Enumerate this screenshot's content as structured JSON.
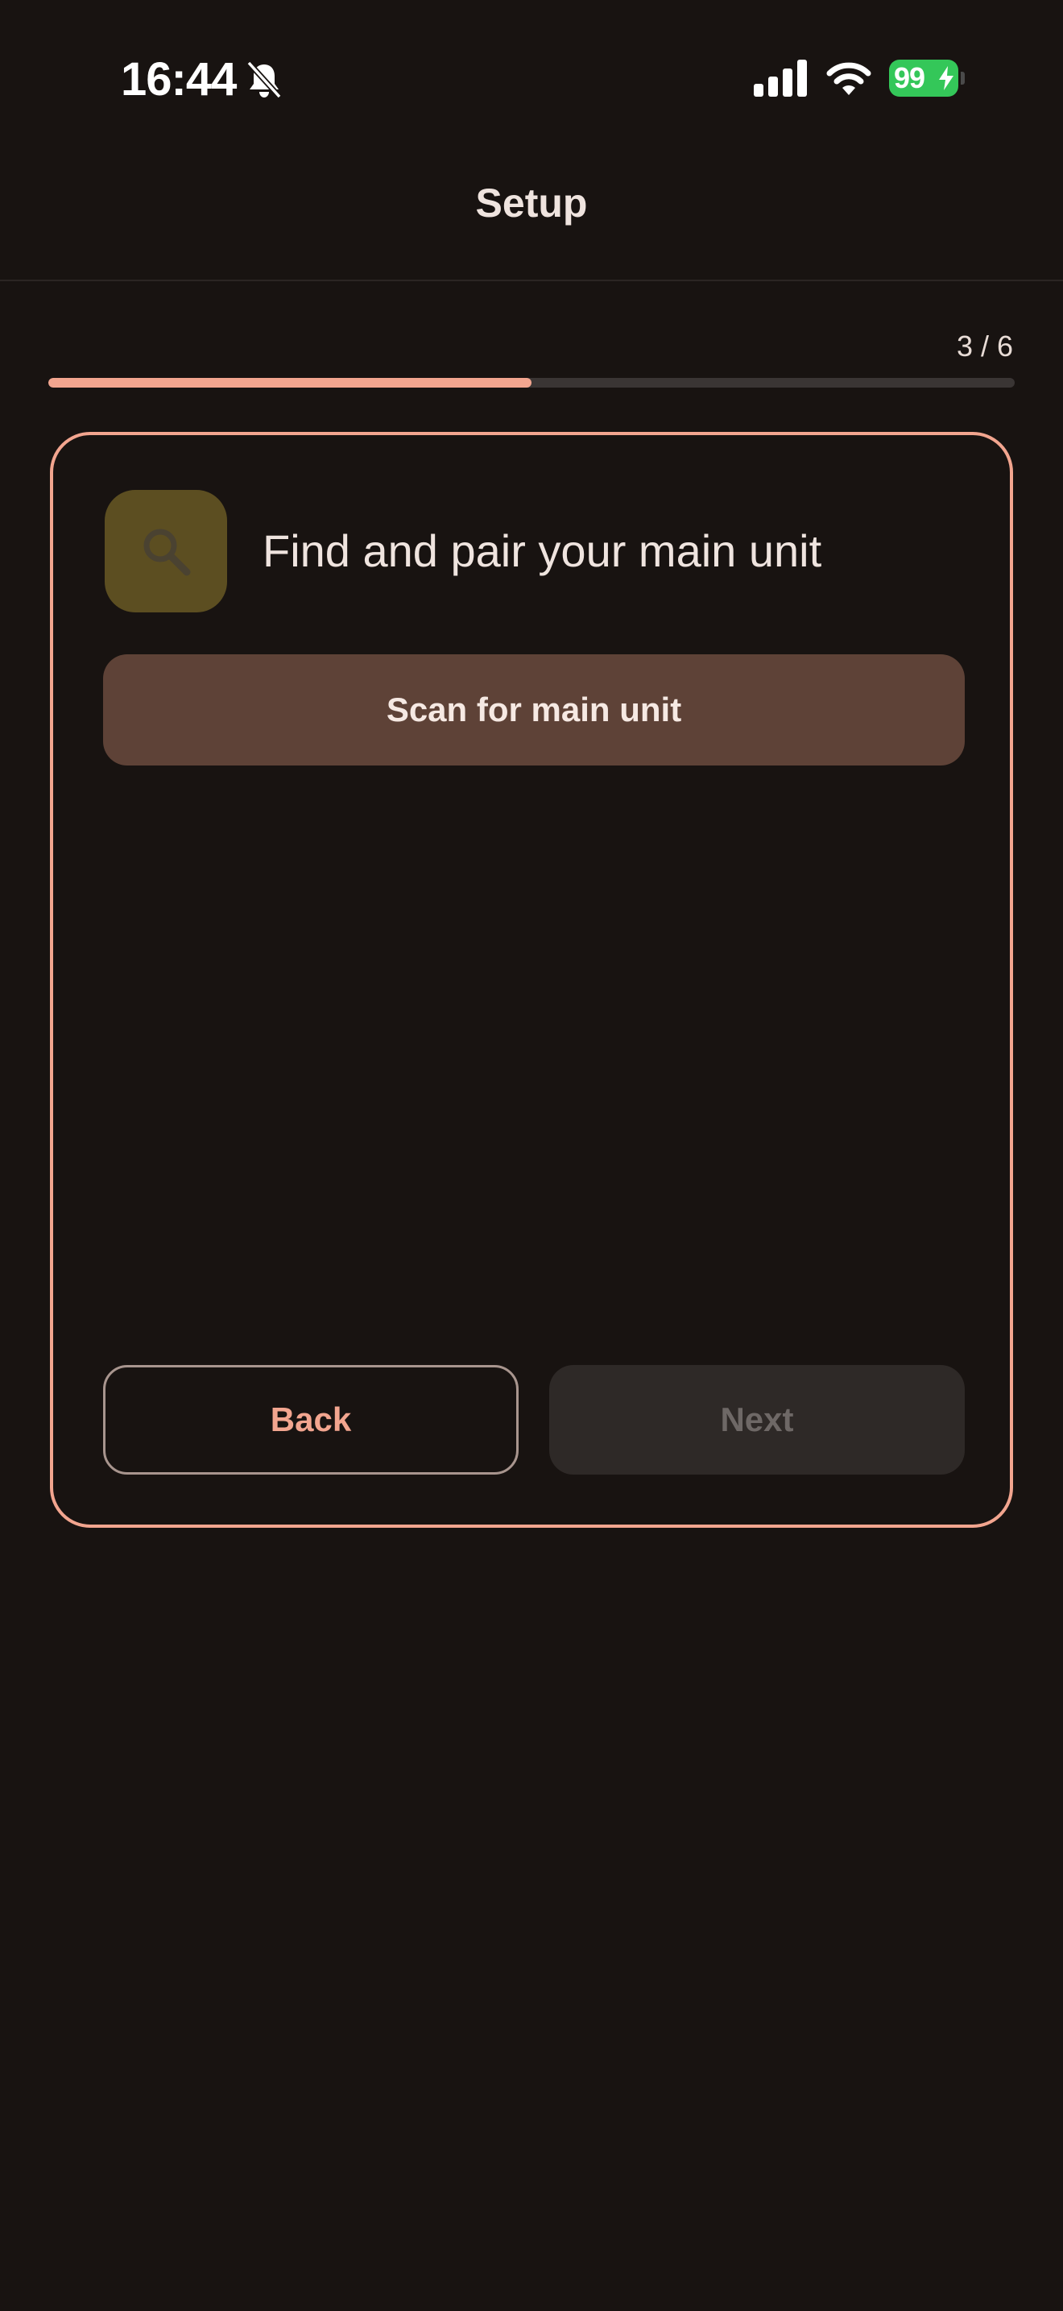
{
  "status_bar": {
    "time": "16:44",
    "battery_level": "99",
    "battery_color": "#34c759"
  },
  "header": {
    "title": "Setup"
  },
  "progress": {
    "label": "3 / 6",
    "current_step": 3,
    "total_steps": 6,
    "fraction": 0.5,
    "accent_color": "#f2a58f"
  },
  "step": {
    "icon": "search-icon",
    "title": "Find and pair your main unit",
    "scan_button_label": "Scan for main unit"
  },
  "navigation": {
    "back_label": "Back",
    "next_label": "Next",
    "next_enabled": false
  }
}
